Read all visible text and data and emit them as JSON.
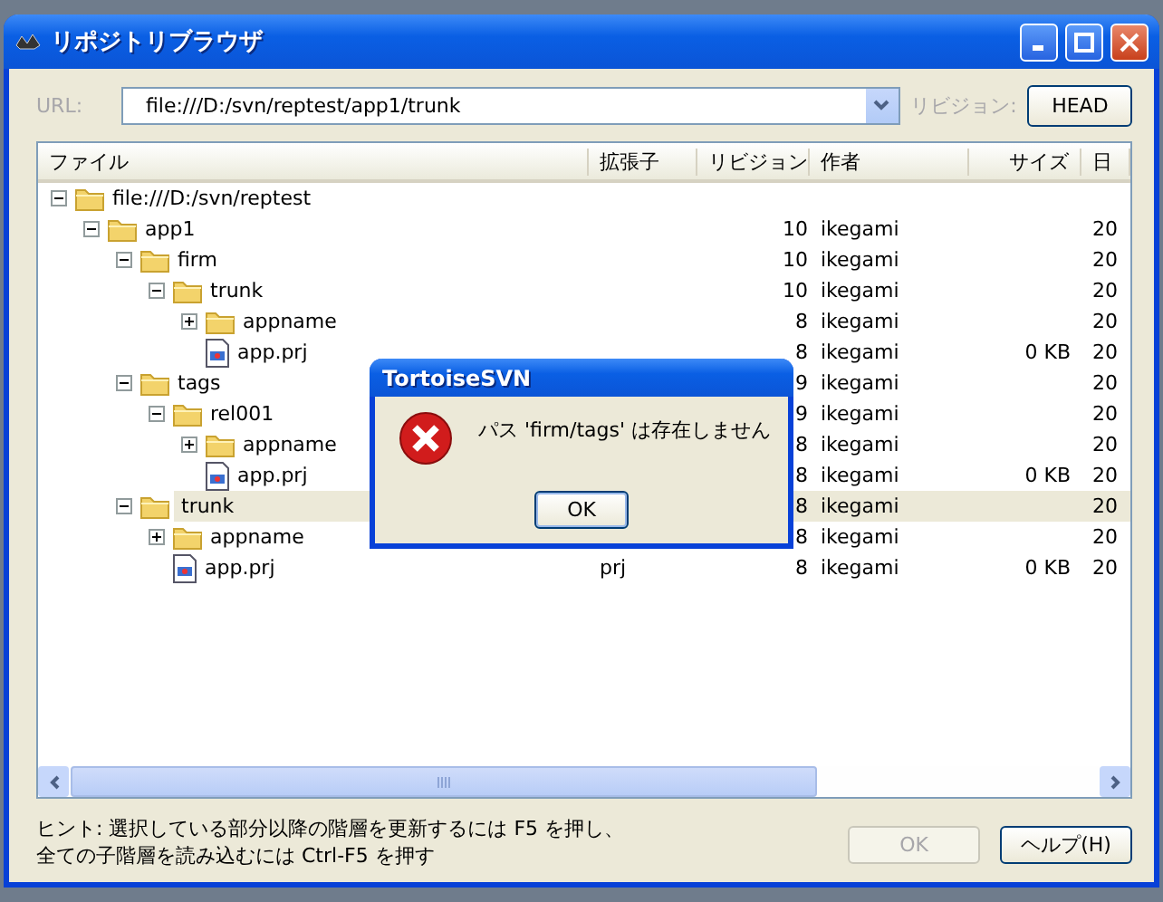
{
  "window": {
    "title": "リポジトリブラウザ"
  },
  "url": {
    "label": "URL:",
    "value": "file:///D:/svn/reptest/app1/trunk"
  },
  "revision": {
    "label": "リビジョン:",
    "button": "HEAD"
  },
  "columns": [
    "ファイル",
    "拡張子",
    "リビジョン",
    "作者",
    "サイズ",
    "日"
  ],
  "tree": [
    {
      "name": "file:///D:/svn/reptest",
      "kind": "folder",
      "expanded": true,
      "selected": false,
      "children": [
        {
          "name": "app1",
          "kind": "folder",
          "expanded": true,
          "selected": false,
          "revision": "10",
          "author": "ikegami",
          "date": "20",
          "children": [
            {
              "name": "firm",
              "kind": "folder",
              "expanded": true,
              "selected": false,
              "revision": "10",
              "author": "ikegami",
              "date": "20",
              "children": [
                {
                  "name": "trunk",
                  "kind": "folder",
                  "expanded": true,
                  "selected": false,
                  "revision": "10",
                  "author": "ikegami",
                  "date": "20",
                  "children": [
                    {
                      "name": "appname",
                      "kind": "folder",
                      "expanded": false,
                      "selected": false,
                      "revision": "8",
                      "author": "ikegami",
                      "date": "20"
                    },
                    {
                      "name": "app.prj",
                      "kind": "file",
                      "selected": false,
                      "revision": "8",
                      "author": "ikegami",
                      "size": "0 KB",
                      "date": "20"
                    }
                  ]
                }
              ]
            },
            {
              "name": "tags",
              "kind": "folder",
              "expanded": true,
              "selected": false,
              "revision": "9",
              "author": "ikegami",
              "date": "20",
              "children": [
                {
                  "name": "rel001",
                  "kind": "folder",
                  "expanded": true,
                  "selected": false,
                  "revision": "9",
                  "author": "ikegami",
                  "date": "20",
                  "children": [
                    {
                      "name": "appname",
                      "kind": "folder",
                      "expanded": false,
                      "selected": false,
                      "revision": "8",
                      "author": "ikegami",
                      "date": "20"
                    },
                    {
                      "name": "app.prj",
                      "kind": "file",
                      "selected": false,
                      "revision": "8",
                      "author": "ikegami",
                      "size": "0 KB",
                      "date": "20"
                    }
                  ]
                }
              ]
            },
            {
              "name": "trunk",
              "kind": "folder",
              "expanded": true,
              "selected": true,
              "revision": "8",
              "author": "ikegami",
              "date": "20",
              "children": [
                {
                  "name": "appname",
                  "kind": "folder",
                  "expanded": false,
                  "selected": false,
                  "revision": "8",
                  "author": "ikegami",
                  "date": "20"
                },
                {
                  "name": "app.prj",
                  "kind": "file",
                  "selected": false,
                  "ext": "prj",
                  "revision": "8",
                  "author": "ikegami",
                  "size": "0 KB",
                  "date": "20"
                }
              ]
            }
          ]
        }
      ]
    }
  ],
  "hint": "ヒント: 選択している部分以降の階層を更新するには F5 を押し、全ての子階層を読み込むには Ctrl-F5 を押す",
  "buttons": [
    {
      "label": "OK",
      "disabled": true
    },
    {
      "label": "ヘルプ(H)",
      "disabled": false
    }
  ],
  "dialog": {
    "title": "TortoiseSVN",
    "message": "パス 'firm/tags' は存在しません",
    "button": "OK"
  }
}
